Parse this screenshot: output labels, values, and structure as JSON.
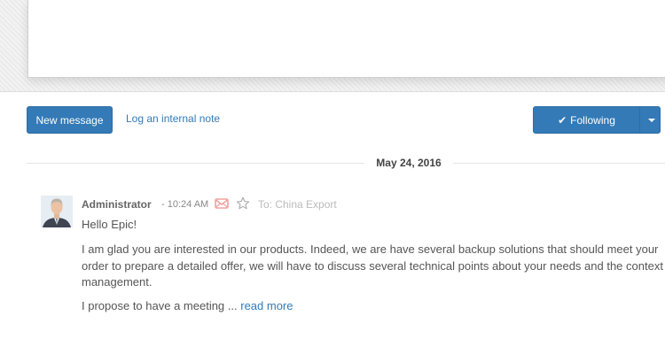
{
  "composer": {
    "new_message_label": "New message",
    "log_note_label": "Log an internal note",
    "following_label": "Following"
  },
  "thread": {
    "date": "May 24, 2016",
    "message": {
      "author": "Administrator",
      "time": "- 10:24 AM",
      "recipient": "To: China Export",
      "greeting": "Hello Epic!",
      "body_line_1": "I am glad you are interested in our products. Indeed, we are have several backup solutions that should meet your",
      "body_line_2": "order to prepare a detailed offer, we will have to discuss several technical points about your needs and the context",
      "body_line_3": "management.",
      "teaser": "I propose to have a meeting ...",
      "read_more": "read more"
    }
  },
  "icons": {
    "check": "check-icon",
    "caret": "caret-down-icon",
    "envelope": "envelope-icon",
    "star": "star-icon"
  },
  "colors": {
    "primary": "#337ab7",
    "link": "#337ab7",
    "envelope": "#f0a0a0",
    "muted": "#bbbbbb"
  }
}
